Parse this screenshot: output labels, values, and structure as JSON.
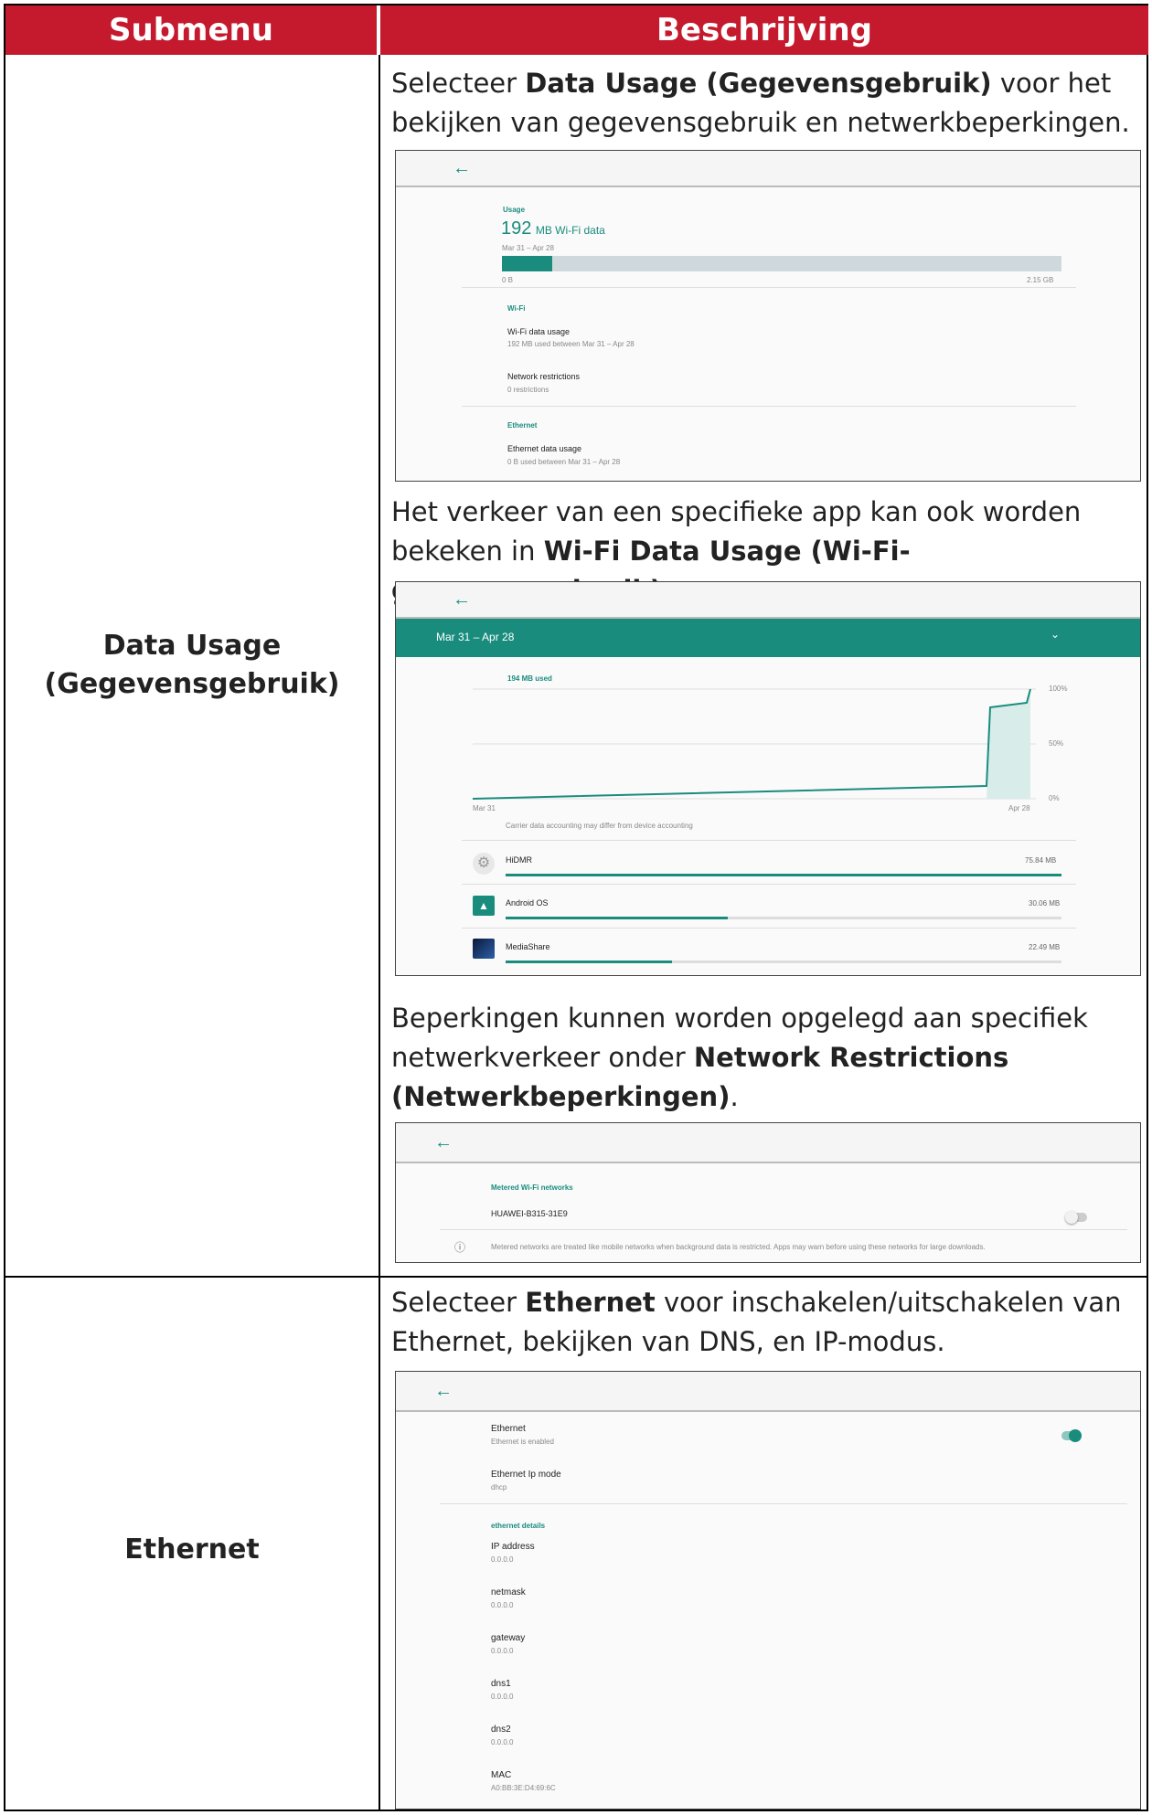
{
  "header": {
    "col1": "Submenu",
    "col2": "Beschrijving"
  },
  "rows": [
    {
      "label_line1": "Data Usage",
      "label_line2": "(Gegevensgebruik)"
    },
    {
      "label": "Ethernet"
    }
  ],
  "paras": {
    "p1_pre": "Selecteer ",
    "p1_bold": "Data Usage (Gegevensgebruik)",
    "p1_post": " voor het bekijken van gegevensgebruik en netwerkbeperkingen.",
    "p2_pre": "Het verkeer van een specifieke app kan ook worden bekeken in ",
    "p2_bold": "Wi-Fi Data Usage (Wi-Fi-gegevensgebruik)",
    "p2_post": ".",
    "p3_pre": "Beperkingen kunnen worden opgelegd aan specifiek netwerkverkeer onder ",
    "p3_bold": "Network Restrictions (Netwerkbeperkingen)",
    "p3_post": ".",
    "p4_pre": "Selecteer ",
    "p4_bold": "Ethernet",
    "p4_post": " voor inschakelen/uitschakelen van Ethernet, bekijken van DNS, en IP-modus."
  },
  "shot1": {
    "back": "←",
    "usage_label": "Usage",
    "amount": "192",
    "amount_unit": "MB Wi-Fi data",
    "period": "Mar 31 – Apr 28",
    "usage_fraction": 0.09,
    "bar_min": "0 B",
    "bar_max": "2.15 GB",
    "wifi_header": "Wi-Fi",
    "wifi_usage_title": "Wi-Fi data usage",
    "wifi_usage_sub": "192 MB used between Mar 31 – Apr 28",
    "restrictions_title": "Network restrictions",
    "restrictions_sub": "0 restrictions",
    "ethernet_header": "Ethernet",
    "eth_usage_title": "Ethernet data usage",
    "eth_usage_sub": "0 B used between Mar 31 – Apr 28"
  },
  "shot2": {
    "back": "←",
    "range": "Mar 31 – Apr 28",
    "chevron": "⌄",
    "used": "194 MB used",
    "y_ticks": [
      "100%",
      "50%",
      "0%"
    ],
    "x_start": "Mar 31",
    "x_end": "Apr 28",
    "note": "Carrier data accounting may differ from device accounting",
    "apps": [
      {
        "name": "HiDMR",
        "size": "75.84 MB",
        "fraction": 1.0,
        "icon": "gear-icon"
      },
      {
        "name": "Android OS",
        "size": "30.06 MB",
        "fraction": 0.4,
        "icon": "android-icon"
      },
      {
        "name": "MediaShare",
        "size": "22.49 MB",
        "fraction": 0.3,
        "icon": "mediashare-icon"
      }
    ]
  },
  "shot3": {
    "back": "←",
    "section": "Metered Wi-Fi networks",
    "network": "HUAWEI-B315-31E9",
    "info": "Metered networks are treated like mobile networks when background data is restricted. Apps may warn before using these networks for large downloads.",
    "info_icon": "ⓘ"
  },
  "shot4": {
    "back": "←",
    "ethernet_title": "Ethernet",
    "ethernet_sub": "Ethernet is enabled",
    "ipmode_title": "Ethernet Ip mode",
    "ipmode_sub": "dhcp",
    "details_header": "ethernet details",
    "details": [
      {
        "label": "IP address",
        "value": "0.0.0.0"
      },
      {
        "label": "netmask",
        "value": "0.0.0.0"
      },
      {
        "label": "gateway",
        "value": "0.0.0.0"
      },
      {
        "label": "dns1",
        "value": "0.0.0.0"
      },
      {
        "label": "dns2",
        "value": "0.0.0.0"
      },
      {
        "label": "MAC",
        "value": "A0:BB:3E:D4:69:6C"
      }
    ]
  },
  "colors": {
    "header_red": "#c5192d",
    "teal": "#1a8c7e"
  }
}
